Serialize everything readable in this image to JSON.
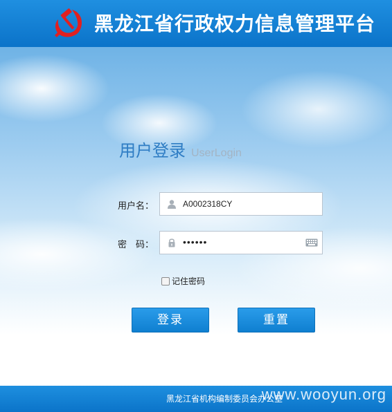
{
  "header": {
    "title": "黑龙江省行政权力信息管理平台",
    "emblem_icon": "party-emblem-icon"
  },
  "login": {
    "title_cn": "用户登录",
    "title_en": "UserLogin",
    "username_label": "用户名：",
    "username_value": "A0002318CY",
    "username_icon": "user-icon",
    "password_label": "密　码：",
    "password_value": "••••••",
    "password_icon": "lock-icon",
    "keyboard_icon": "keyboard-icon",
    "remember_label": "记住密码",
    "remember_checked": false,
    "login_button": "登录",
    "reset_button": "重置"
  },
  "footer": {
    "text": "黑龙江省机构编制委员会办公室",
    "watermark": "www.wooyun.org"
  },
  "colors": {
    "header_blue": "#0b73c9",
    "title_blue": "#2f7dc4",
    "button_blue": "#1b8fe0",
    "emblem_red": "#e02020"
  }
}
